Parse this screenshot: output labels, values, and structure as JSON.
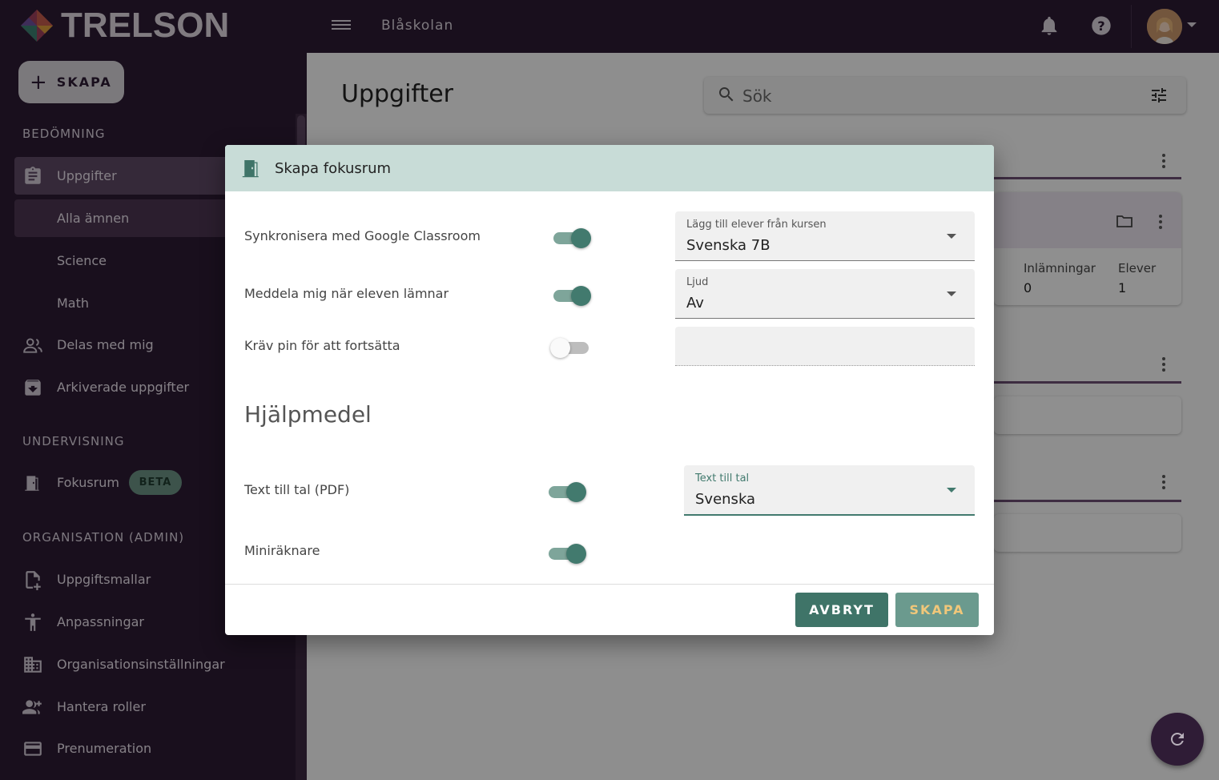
{
  "app": {
    "brand": "TRELSON",
    "org_name": "Blåskolan"
  },
  "sidebar": {
    "create_label": "SKAPA",
    "sections": {
      "assessment": "BEDÖMNING",
      "teaching": "UNDERVISNING",
      "organization": "ORGANISATION (ADMIN)"
    },
    "items": {
      "tasks": "Uppgifter",
      "all_subjects": "Alla ämnen",
      "science": "Science",
      "math": "Math",
      "shared": "Delas med mig",
      "archived": "Arkiverade uppgifter",
      "focus_room": "Fokusrum",
      "beta": "BETA",
      "templates": "Uppgiftsmallar",
      "adaptations": "Anpassningar",
      "org_settings": "Organisationsinställningar",
      "roles": "Hantera roller",
      "subscription": "Prenumeration"
    }
  },
  "main": {
    "title": "Uppgifter",
    "search_placeholder": "Sök",
    "stats": {
      "submissions_label": "Inlämningar",
      "submissions_value": "0",
      "students_label": "Elever",
      "students_value": "1"
    }
  },
  "dialog": {
    "title": "Skapa fokusrum",
    "rows": {
      "sync_label": "Synkronisera med Google Classroom",
      "notify_label": "Meddela mig när eleven lämnar",
      "pin_label": "Kräv pin för att fortsätta",
      "tts_label": "Text till tal (PDF)",
      "calc_label": "Miniräknare"
    },
    "selects": {
      "course_label": "Lägg till elever från kursen",
      "course_value": "Svenska 7B",
      "sound_label": "Ljud",
      "sound_value": "Av",
      "tts_label": "Text till tal",
      "tts_value": "Svenska"
    },
    "aids_heading": "Hjälpmedel",
    "cancel_label": "AVBRYT",
    "create_label": "SKAPA"
  },
  "colors": {
    "primary": "#427a6e",
    "sidebar_bg": "#2c1a33",
    "accent_text": "#f0c77a"
  }
}
